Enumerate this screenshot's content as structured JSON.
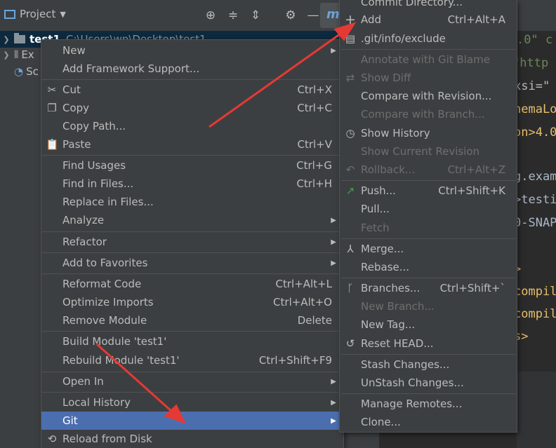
{
  "project_panel": {
    "title": "Project",
    "tree": [
      {
        "name": "test1",
        "path": "C:\\Users\\wn\\Desktop\\test1"
      },
      {
        "name": "Ex"
      },
      {
        "name": "Sc"
      }
    ]
  },
  "editor": {
    "tab_letter": "m",
    "lines": [
      ".0\"  c",
      "\"http",
      "xsi=\"",
      "hemaLo",
      "on>4.0",
      "",
      "g.exam",
      ">testi",
      "0-SNAP",
      "",
      ">",
      "compil",
      "compil",
      "s>"
    ]
  },
  "context_menu": {
    "items": [
      {
        "label": "New",
        "submenu": true
      },
      {
        "label": "Add Framework Support..."
      },
      {
        "label": "Cut",
        "shortcut": "Ctrl+X",
        "icon": "cut-icon"
      },
      {
        "label": "Copy",
        "shortcut": "Ctrl+C",
        "icon": "copy-icon"
      },
      {
        "label": "Copy Path..."
      },
      {
        "label": "Paste",
        "shortcut": "Ctrl+V",
        "icon": "paste-icon"
      },
      {
        "label": "Find Usages",
        "shortcut": "Ctrl+G"
      },
      {
        "label": "Find in Files...",
        "shortcut": "Ctrl+H"
      },
      {
        "label": "Replace in Files..."
      },
      {
        "label": "Analyze",
        "submenu": true
      },
      {
        "label": "Refactor",
        "submenu": true
      },
      {
        "label": "Add to Favorites",
        "submenu": true
      },
      {
        "label": "Reformat Code",
        "shortcut": "Ctrl+Alt+L"
      },
      {
        "label": "Optimize Imports",
        "shortcut": "Ctrl+Alt+O"
      },
      {
        "label": "Remove Module",
        "shortcut": "Delete"
      },
      {
        "label": "Build Module 'test1'"
      },
      {
        "label": "Rebuild Module 'test1'",
        "shortcut": "Ctrl+Shift+F9"
      },
      {
        "label": "Open In",
        "submenu": true
      },
      {
        "label": "Local History",
        "submenu": true
      },
      {
        "label": "Git",
        "submenu": true,
        "selected": true
      },
      {
        "label": "Reload from Disk",
        "icon": "reload-icon"
      }
    ]
  },
  "git_menu": {
    "items": [
      {
        "label": "Commit Directory..."
      },
      {
        "label": "Add",
        "shortcut": "Ctrl+Alt+A",
        "icon": "plus-icon"
      },
      {
        "label": ".git/info/exclude",
        "icon": "git-file-icon"
      },
      {
        "label": "Annotate with Git Blame",
        "disabled": true
      },
      {
        "label": "Show Diff",
        "disabled": true,
        "icon": "diff-icon"
      },
      {
        "label": "Compare with Revision..."
      },
      {
        "label": "Compare with Branch...",
        "disabled": true
      },
      {
        "label": "Show History",
        "icon": "clock-icon"
      },
      {
        "label": "Show Current Revision",
        "disabled": true
      },
      {
        "label": "Rollback...",
        "shortcut": "Ctrl+Alt+Z",
        "disabled": true,
        "icon": "rollback-icon"
      },
      {
        "label": "Push...",
        "shortcut": "Ctrl+Shift+K",
        "icon": "push-icon"
      },
      {
        "label": "Pull..."
      },
      {
        "label": "Fetch",
        "disabled": true
      },
      {
        "label": "Merge...",
        "icon": "merge-icon"
      },
      {
        "label": "Rebase..."
      },
      {
        "label": "Branches...",
        "shortcut": "Ctrl+Shift+`",
        "icon": "branch-icon"
      },
      {
        "label": "New Branch...",
        "disabled": true
      },
      {
        "label": "New Tag..."
      },
      {
        "label": "Reset HEAD...",
        "icon": "reset-icon"
      },
      {
        "label": "Stash Changes..."
      },
      {
        "label": "UnStash Changes..."
      },
      {
        "label": "Manage Remotes..."
      },
      {
        "label": "Clone..."
      }
    ]
  }
}
